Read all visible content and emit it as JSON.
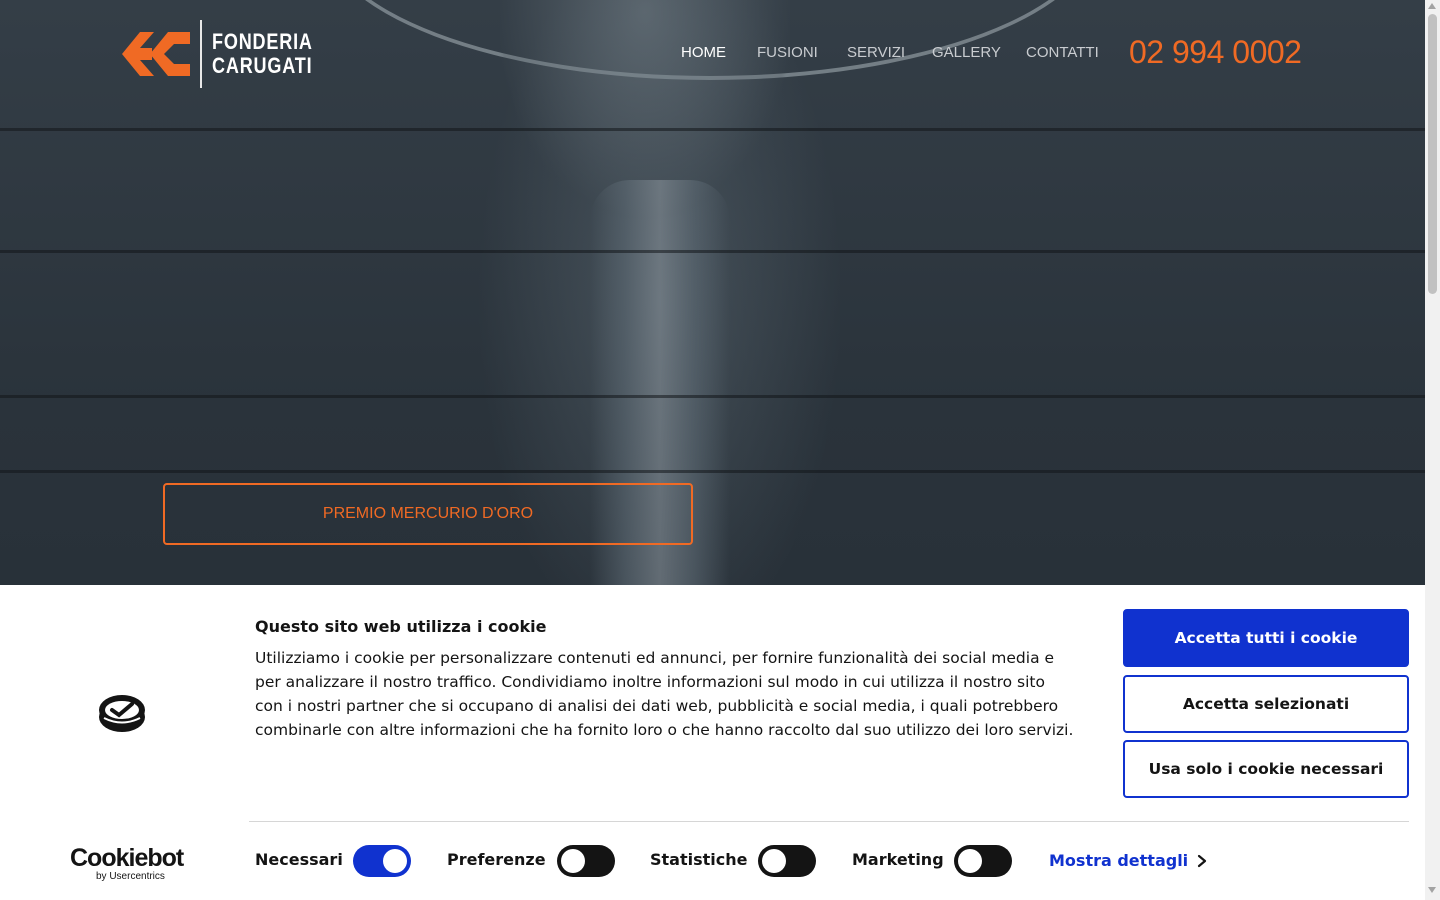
{
  "header": {
    "logo": {
      "line1": "FONDERIA",
      "line2": "CARUGATI",
      "mark_color": "#f06a24"
    },
    "nav": [
      {
        "label": "HOME",
        "active": true
      },
      {
        "label": "FUSIONI",
        "active": false
      },
      {
        "label": "SERVIZI",
        "active": false
      },
      {
        "label": "GALLERY",
        "active": false
      },
      {
        "label": "CONTATTI",
        "active": false
      }
    ],
    "phone": "02 994 0002"
  },
  "hero": {
    "cta_label": "PREMIO MERCURIO D'ORO"
  },
  "cookie_banner": {
    "title": "Questo sito web utilizza i cookie",
    "body": "Utilizziamo i cookie per personalizzare contenuti ed annunci, per fornire funzionalità dei social media e per analizzare il nostro traffico. Condividiamo inoltre informazioni sul modo in cui utilizza il nostro sito con i nostri partner che si occupano di analisi dei dati web, pubblicità e social media, i quali potrebbero combinarle con altre informazioni che ha fornito loro o che hanno raccolto dal suo utilizzo dei loro servizi.",
    "buttons": {
      "accept_all": "Accetta tutti i cookie",
      "accept_selected": "Accetta selezionati",
      "necessary_only": "Usa solo i cookie necessari"
    },
    "toggles": [
      {
        "label": "Necessari",
        "on": true
      },
      {
        "label": "Preferenze",
        "on": false
      },
      {
        "label": "Statistiche",
        "on": false
      },
      {
        "label": "Marketing",
        "on": false
      }
    ],
    "show_details": "Mostra dettagli",
    "brand": {
      "name": "Cookiebot",
      "sub": "by Usercentrics"
    }
  },
  "colors": {
    "accent_orange": "#f06a24",
    "cookie_blue": "#1032cf"
  }
}
